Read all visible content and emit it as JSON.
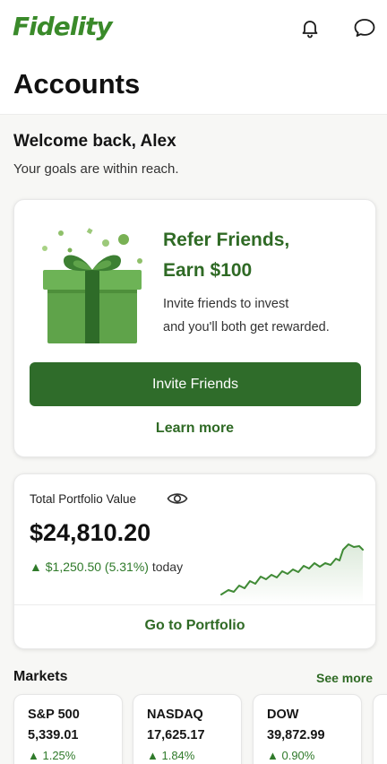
{
  "brand": {
    "logo_text": "Fidelity",
    "accent": "#2f6c2a",
    "logo_color": "#3a8a2a"
  },
  "header": {
    "icons": [
      "bell-icon",
      "chat-icon"
    ]
  },
  "page": {
    "title": "Accounts"
  },
  "welcome": {
    "greeting": "Welcome back, Alex",
    "subtitle": "Your goals are within reach."
  },
  "referral": {
    "title_line1": "Refer Friends,",
    "title_line2": "Earn $100",
    "desc_line1": "Invite friends to invest",
    "desc_line2": "and you'll both get rewarded.",
    "button_label": "Invite Friends",
    "link_label": "Learn more"
  },
  "portfolio": {
    "label": "Total Portfolio Value",
    "value": "$24,810.20",
    "change": "▲ $1,250.50 (5.31%)",
    "change_period": "today",
    "cta": "Go to Portfolio",
    "trend_color": "#3f8a35"
  },
  "markets": {
    "title": "Markets",
    "see_more": "See more",
    "items": [
      {
        "name": "S&P 500",
        "value": "5,339.01",
        "change": "▲ 1.25%"
      },
      {
        "name": "NASDAQ",
        "value": "17,625.17",
        "change": "▲ 1.84%"
      },
      {
        "name": "DOW",
        "value": "39,872.99",
        "change": "▲ 0.90%"
      }
    ]
  }
}
